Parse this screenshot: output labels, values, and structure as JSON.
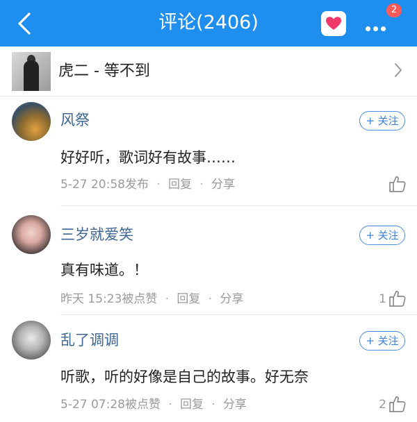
{
  "header": {
    "title": "评论(2406)",
    "badge": "2"
  },
  "song": {
    "title": "虎二 - 等不到"
  },
  "comments": [
    {
      "username": "风祭",
      "follow_label": "+ 关注",
      "text": "好好听，歌词好有故事……",
      "time": "5-27 20:58发布",
      "reply_label": "回复",
      "share_label": "分享",
      "likes": ""
    },
    {
      "username": "三岁就爱笑",
      "follow_label": "+ 关注",
      "text": "真有味道。！",
      "time": "昨天 15:23被点赞",
      "reply_label": "回复",
      "share_label": "分享",
      "likes": "1"
    },
    {
      "username": "乱了调调",
      "follow_label": "+ 关注",
      "text": "听歌，听的好像是自己的故事。好无奈",
      "time": "5-27 07:28被点赞",
      "reply_label": "回复",
      "share_label": "分享",
      "likes": "2"
    }
  ],
  "colors": {
    "header_bg": "#1e8fef",
    "username": "#3d6591",
    "follow": "#3f80d6",
    "heart": "#f0386b",
    "badge": "#ff5a5a"
  },
  "icons": {
    "back": "chevron-left-icon",
    "favorite": "heart-icon",
    "more": "more-dots-icon",
    "song_arrow": "chevron-right-icon",
    "like": "thumbs-up-icon"
  }
}
